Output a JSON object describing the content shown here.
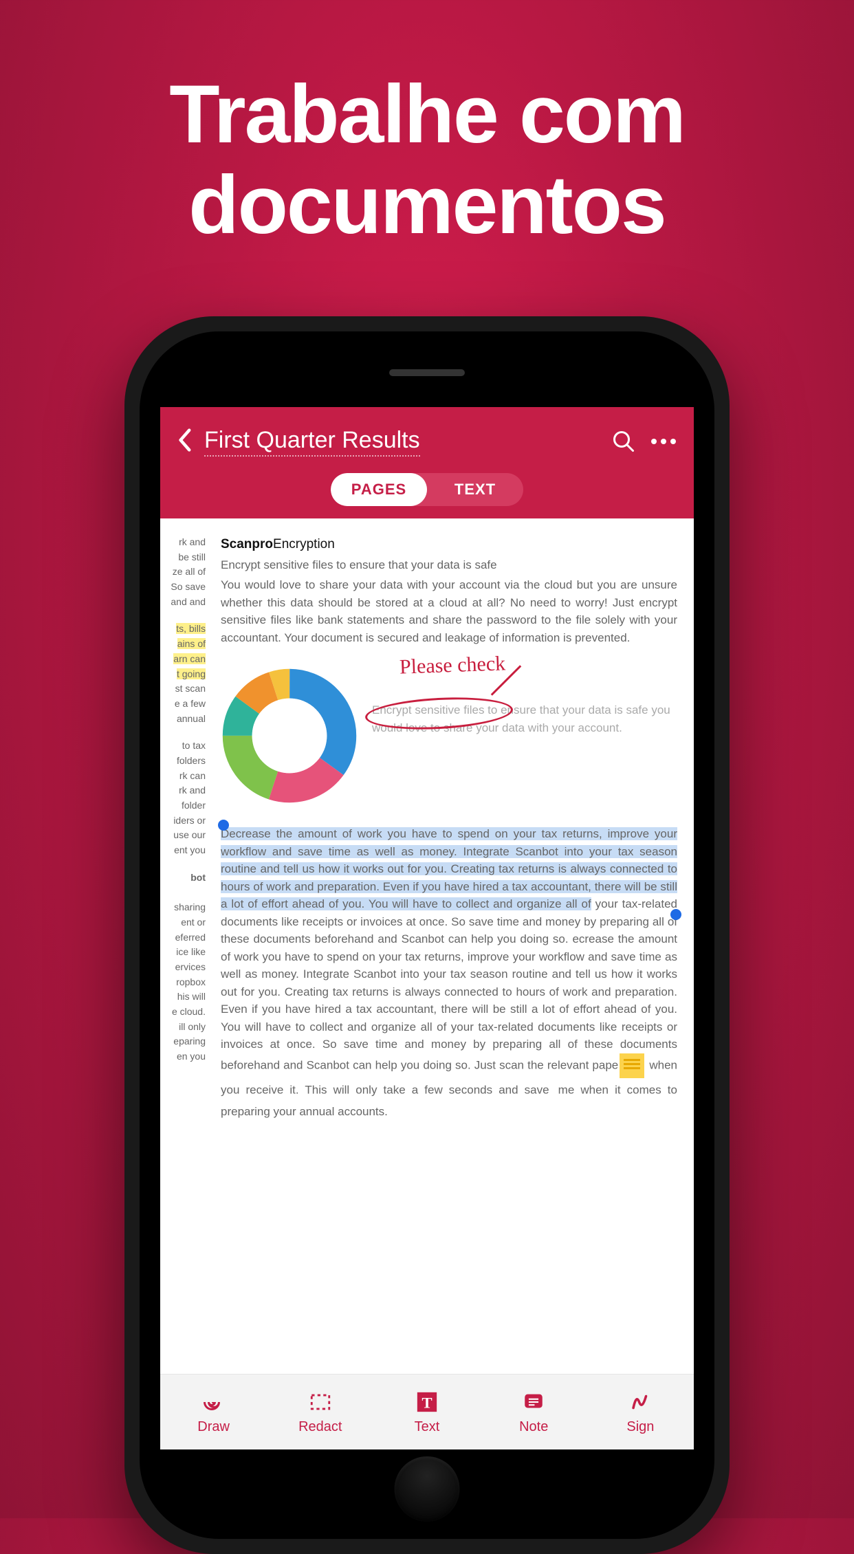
{
  "marketing": {
    "headline_line1": "Trabalhe com",
    "headline_line2": "documentos"
  },
  "header": {
    "title": "First Quarter Results",
    "tabs": {
      "pages": "PAGES",
      "text": "TEXT"
    }
  },
  "document": {
    "brand": "Scanpro",
    "section_title": "Encryption",
    "subtitle": "Encrypt sensitive files to ensure that your data is safe",
    "intro": "You would love to share your data with your account via the cloud but you are unsure whether this data should be stored at a cloud at all? No need to worry! Just encrypt sensitive files like bank statements and share the password to the file solely with your accountant. Your document is secured and leakage of information is prevented.",
    "handwriting": "Please check",
    "chart_caption": "Encrypt sensitive files to ensure that your data is safe you would love to share your data with your account.",
    "selected_text": "Decrease the amount of work you have to spend on your tax returns, improve your workflow and save time as well as money. Integrate Scanbot into your tax season routine and tell us how it works out for you. Creating tax returns is always connected to hours of work and preparation. Even if you have hired a tax accountant, there will be still a lot of effort ahead of you. You will have to collect and organize all of",
    "body_rest_a": " your tax-related documents like receipts or invoices at once. So save time and money by preparing all of these documents beforehand and Scanbot can help you doing so. ecrease the amount of work you have to spend on your tax returns, improve your workflow and save time as well as money. Integrate Scanbot into your tax season routine and tell us how it works out for you. Creating tax returns is always connected to hours of work and preparation. Even if you have hired a tax accountant, there will be still a lot of effort ahead of you. You will have to collect and organize all of your tax-related documents like receipts or invoices at once. So save time and money by preparing all of these documents beforehand and Scanbot can help you doing so. Just scan the relevant pape",
    "body_rest_b": " when you receive it. This will only take a few seconds and save ",
    "body_rest_c": "me when it comes to preparing your annual accounts.",
    "left_fragments": {
      "p1": "rk and\nbe still\nze all of\nSo save\nand and",
      "p2_a": "ts, bills",
      "p2_b": "ains of",
      "p2_c": "arn can",
      "p2_d": "t going",
      "p2_e": "st scan\ne a few\nannual",
      "p3": "to tax\nfolders\nrk can\nrk and\nfolder\niders or\nuse our\nent you",
      "p4_head": "bot",
      "p4": "sharing\nent or\neferred\nice like\nervices\nropbox\nhis will\ne cloud.\nill only\neparing\nen you"
    }
  },
  "chart_data": {
    "type": "pie",
    "title": "",
    "series": [
      {
        "name": "Blue",
        "value": 35,
        "color": "#2f8fd8"
      },
      {
        "name": "Pink",
        "value": 20,
        "color": "#e6537a"
      },
      {
        "name": "Green",
        "value": 20,
        "color": "#7fc24b"
      },
      {
        "name": "Teal",
        "value": 10,
        "color": "#2fb39a"
      },
      {
        "name": "Orange",
        "value": 10,
        "color": "#f0922d"
      },
      {
        "name": "Yellow",
        "value": 5,
        "color": "#f5c13d"
      }
    ]
  },
  "toolbar": {
    "draw": "Draw",
    "redact": "Redact",
    "text": "Text",
    "note": "Note",
    "sign": "Sign"
  }
}
